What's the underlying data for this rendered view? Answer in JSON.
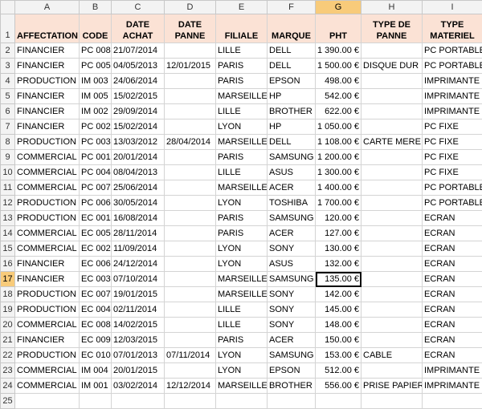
{
  "columns": [
    "A",
    "B",
    "C",
    "D",
    "E",
    "F",
    "G",
    "H",
    "I"
  ],
  "selected_column": "G",
  "selected_row": "17",
  "headers": [
    "AFFECTATION",
    "CODE",
    "DATE ACHAT",
    "DATE PANNE",
    "FILIALE",
    "MARQUE",
    "PHT",
    "TYPE DE PANNE",
    "TYPE MATERIEL"
  ],
  "rows": [
    {
      "n": "2",
      "c": [
        "FINANCIER",
        "PC 008",
        "21/07/2014",
        "",
        "LILLE",
        "DELL",
        "1 390.00 €",
        "",
        "PC PORTABLE"
      ]
    },
    {
      "n": "3",
      "c": [
        "FINANCIER",
        "PC 005",
        "04/05/2013",
        "12/01/2015",
        "PARIS",
        "DELL",
        "1 500.00 €",
        "DISQUE DUR",
        "PC PORTABLE"
      ]
    },
    {
      "n": "4",
      "c": [
        "PRODUCTION",
        "IM 003",
        "24/06/2014",
        "",
        "PARIS",
        "EPSON",
        "498.00 €",
        "",
        "IMPRIMANTE"
      ]
    },
    {
      "n": "5",
      "c": [
        "FINANCIER",
        "IM 005",
        "15/02/2015",
        "",
        "MARSEILLE",
        "HP",
        "542.00 €",
        "",
        "IMPRIMANTE"
      ]
    },
    {
      "n": "6",
      "c": [
        "FINANCIER",
        "IM 002",
        "29/09/2014",
        "",
        "LILLE",
        "BROTHER",
        "622.00 €",
        "",
        "IMPRIMANTE"
      ]
    },
    {
      "n": "7",
      "c": [
        "FINANCIER",
        "PC 002",
        "15/02/2014",
        "",
        "LYON",
        "HP",
        "1 050.00 €",
        "",
        "PC FIXE"
      ]
    },
    {
      "n": "8",
      "c": [
        "PRODUCTION",
        "PC 003",
        "13/03/2012",
        "28/04/2014",
        "MARSEILLE",
        "DELL",
        "1 108.00 €",
        "CARTE MERE",
        "PC FIXE"
      ]
    },
    {
      "n": "9",
      "c": [
        "COMMERCIAL",
        "PC 001",
        "20/01/2014",
        "",
        "PARIS",
        "SAMSUNG",
        "1 200.00 €",
        "",
        "PC FIXE"
      ]
    },
    {
      "n": "10",
      "c": [
        "COMMERCIAL",
        "PC 004",
        "08/04/2013",
        "",
        "LILLE",
        "ASUS",
        "1 300.00 €",
        "",
        "PC FIXE"
      ]
    },
    {
      "n": "11",
      "c": [
        "COMMERCIAL",
        "PC 007",
        "25/06/2014",
        "",
        "MARSEILLE",
        "ACER",
        "1 400.00 €",
        "",
        "PC PORTABLE"
      ]
    },
    {
      "n": "12",
      "c": [
        "PRODUCTION",
        "PC 006",
        "30/05/2014",
        "",
        "LYON",
        "TOSHIBA",
        "1 700.00 €",
        "",
        "PC PORTABLE"
      ]
    },
    {
      "n": "13",
      "c": [
        "PRODUCTION",
        "EC 001",
        "16/08/2014",
        "",
        "PARIS",
        "SAMSUNG",
        "120.00 €",
        "",
        "ECRAN"
      ]
    },
    {
      "n": "14",
      "c": [
        "COMMERCIAL",
        "EC 005",
        "28/11/2014",
        "",
        "PARIS",
        "ACER",
        "127.00 €",
        "",
        "ECRAN"
      ]
    },
    {
      "n": "15",
      "c": [
        "COMMERCIAL",
        "EC 002",
        "11/09/2014",
        "",
        "LYON",
        "SONY",
        "130.00 €",
        "",
        "ECRAN"
      ]
    },
    {
      "n": "16",
      "c": [
        "FINANCIER",
        "EC 006",
        "24/12/2014",
        "",
        "LYON",
        "ASUS",
        "132.00 €",
        "",
        "ECRAN"
      ]
    },
    {
      "n": "17",
      "c": [
        "FINANCIER",
        "EC 003",
        "07/10/2014",
        "",
        "MARSEILLE",
        "SAMSUNG",
        "135.00 €",
        "",
        "ECRAN"
      ]
    },
    {
      "n": "18",
      "c": [
        "PRODUCTION",
        "EC 007",
        "19/01/2015",
        "",
        "MARSEILLE",
        "SONY",
        "142.00 €",
        "",
        "ECRAN"
      ]
    },
    {
      "n": "19",
      "c": [
        "PRODUCTION",
        "EC 004",
        "02/11/2014",
        "",
        "LILLE",
        "SONY",
        "145.00 €",
        "",
        "ECRAN"
      ]
    },
    {
      "n": "20",
      "c": [
        "COMMERCIAL",
        "EC 008",
        "14/02/2015",
        "",
        "LILLE",
        "SONY",
        "148.00 €",
        "",
        "ECRAN"
      ]
    },
    {
      "n": "21",
      "c": [
        "FINANCIER",
        "EC 009",
        "12/03/2015",
        "",
        "PARIS",
        "ACER",
        "150.00 €",
        "",
        "ECRAN"
      ]
    },
    {
      "n": "22",
      "c": [
        "PRODUCTION",
        "EC 010",
        "07/01/2013",
        "07/11/2014",
        "LYON",
        "SAMSUNG",
        "153.00 €",
        "CABLE",
        "ECRAN"
      ]
    },
    {
      "n": "23",
      "c": [
        "COMMERCIAL",
        "IM 004",
        "20/01/2015",
        "",
        "LYON",
        "EPSON",
        "512.00 €",
        "",
        "IMPRIMANTE"
      ]
    },
    {
      "n": "24",
      "c": [
        "COMMERCIAL",
        "IM 001",
        "03/02/2014",
        "12/12/2014",
        "MARSEILLE",
        "BROTHER",
        "556.00 €",
        "PRISE PAPIER",
        "IMPRIMANTE"
      ]
    },
    {
      "n": "25",
      "c": [
        "",
        "",
        "",
        "",
        "",
        "",
        "",
        "",
        ""
      ]
    }
  ]
}
